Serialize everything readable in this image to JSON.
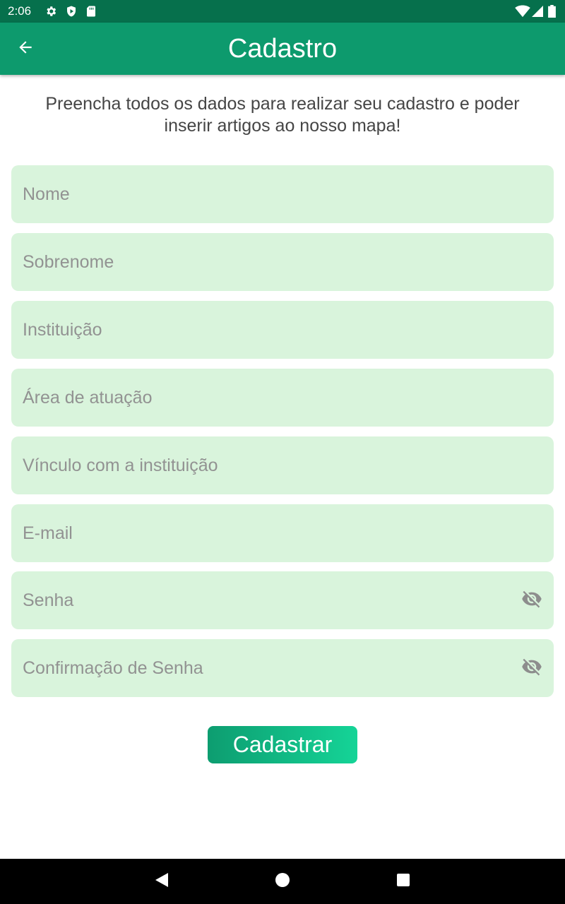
{
  "status_bar": {
    "time": "2:06",
    "left_icons": [
      "settings-icon",
      "shield-icon",
      "sd-card-icon"
    ],
    "right_icons": [
      "wifi-icon",
      "signal-icon",
      "battery-icon"
    ]
  },
  "app_bar": {
    "title": "Cadastro",
    "back_icon": "arrow-back-icon",
    "color": "#0d9a6d"
  },
  "intro_text": "Preencha todos os dados para realizar seu cadastro e poder inserir artigos ao nosso mapa!",
  "form": {
    "fields": [
      {
        "placeholder": "Nome",
        "value": ""
      },
      {
        "placeholder": "Sobrenome",
        "value": ""
      },
      {
        "placeholder": "Instituição",
        "value": ""
      },
      {
        "placeholder": "Área de atuação",
        "value": ""
      },
      {
        "placeholder": "Vínculo com a instituição",
        "value": ""
      },
      {
        "placeholder": "E-mail",
        "value": ""
      },
      {
        "placeholder": "Senha",
        "value": "",
        "toggle_icon": "visibility-off-icon"
      },
      {
        "placeholder": "Confirmação de Senha",
        "value": "",
        "toggle_icon": "visibility-off-icon"
      }
    ],
    "field_background": "#d9f4dc",
    "submit_label": "Cadastrar"
  },
  "nav_bar": {
    "icons": [
      "back-triangle-icon",
      "home-circle-icon",
      "recents-square-icon"
    ]
  }
}
